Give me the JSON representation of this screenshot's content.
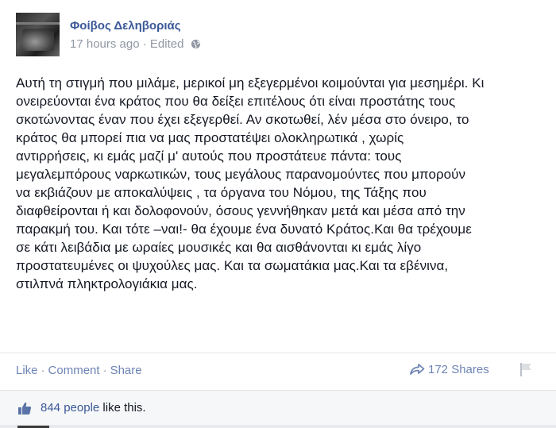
{
  "header": {
    "author_name": "Φοίβος Δεληβοριάς",
    "timestamp": "17 hours ago",
    "separator": "·",
    "edited_label": "Edited",
    "privacy_icon": "globe-icon"
  },
  "post": {
    "text": "Αυτή τη στιγμή που μιλάμε, μερικοί μη εξεγερμένοι κοιμούνται για μεσημέρι. Κι\nονειρεύονται ένα κράτος που θα δείξει επιτέλους ότι είναι προστάτης τους\nσκοτώνοντας έναν που έχει εξεγερθεί. Αν σκοτωθεί, λέν μέσα στο όνειρο, το\nκράτος θα μπορεί πια να μας προστατέψει ολοκληρωτικά , χωρίς\nαντιρρήσεις, κι εμάς μαζί μ' αυτούς που προστάτευε πάντα: τους\nμεγαλεμπόρους ναρκωτικών, τους μεγάλους παρανομούντες που μπορούν\nνα εκβιάζουν με αποκαλύψεις , τα όργανα του Νόμου, της Τάξης που\nδιαφθείρονται ή και δολοφονούν, όσους γεννήθηκαν μετά και μέσα από την\nπαρακμή του. Και τότε –ναι!- θα έχουμε ένα δυνατό Κράτος.Και θα τρέχουμε\nσε κάτι λειβάδια με ωραίες μουσικές και θα αισθάνονται κι εμάς λίγο\nπροστατευμένες οι ψυχούλες μας. Και τα σωματάκια μας.Και τα εβένινα,\nστιλπνά πληκτρολογιάκια μας."
  },
  "actions": {
    "like_label": "Like",
    "comment_label": "Comment",
    "share_label": "Share",
    "dot": "·",
    "shares_count": "172 Shares",
    "share_icon": "share-arrow-icon",
    "flag_icon": "flag-icon"
  },
  "likes": {
    "count": "844 people",
    "suffix": " like this.",
    "icon": "thumbs-up-icon"
  },
  "colors": {
    "link": "#3b5998",
    "action_link": "#6d84b4",
    "meta": "#9197a3",
    "text": "#141823"
  }
}
